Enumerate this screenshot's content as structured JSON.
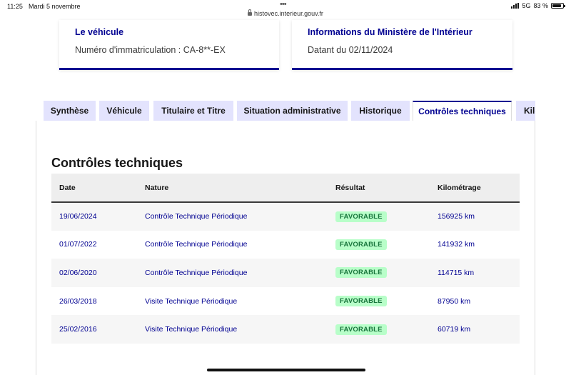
{
  "statusbar": {
    "time": "11:25",
    "date": "Mardi 5 novembre",
    "dots": "•••",
    "network": "5G",
    "battery": "83 %",
    "battery_level": 0.83
  },
  "browser": {
    "url": "histovec.interieur.gouv.fr"
  },
  "cards": {
    "vehicule": {
      "title": "Le véhicule",
      "text": "Numéro d'immatriculation : CA-8**-EX"
    },
    "ministere": {
      "title": "Informations du Ministère de l'Intérieur",
      "text": "Datant du 02/11/2024"
    }
  },
  "tabs": [
    {
      "label": "Synthèse"
    },
    {
      "label": "Véhicule"
    },
    {
      "label": "Titulaire et Titre"
    },
    {
      "label": "Situation administrative"
    },
    {
      "label": "Historique"
    },
    {
      "label": "Contrôles techniques",
      "active": true
    },
    {
      "label": "Kilométrage"
    }
  ],
  "section": {
    "title": "Contrôles techniques"
  },
  "table": {
    "headers": [
      "Date",
      "Nature",
      "Résultat",
      "Kilométrage"
    ],
    "rows": [
      [
        "19/06/2024",
        "Contrôle Technique Périodique",
        "FAVORABLE",
        "156925 km"
      ],
      [
        "01/07/2022",
        "Contrôle Technique Périodique",
        "FAVORABLE",
        "141932 km"
      ],
      [
        "02/06/2020",
        "Contrôle Technique Périodique",
        "FAVORABLE",
        "114715 km"
      ],
      [
        "26/03/2018",
        "Visite Technique Périodique",
        "FAVORABLE",
        "87950 km"
      ],
      [
        "25/02/2016",
        "Visite Technique Périodique",
        "FAVORABLE",
        "60719 km"
      ]
    ]
  },
  "colors": {
    "accent": "#000091",
    "tab_bg": "#e3e3fd",
    "badge_bg": "#b8fec9",
    "badge_text": "#18753c"
  }
}
